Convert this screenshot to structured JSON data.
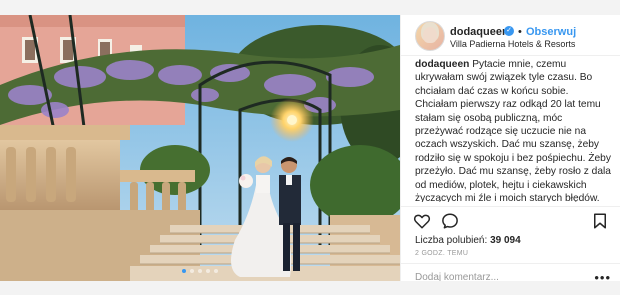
{
  "post": {
    "username": "dodaqueen",
    "verified_mark": "✓",
    "separator": "•",
    "follow_label": "Obserwuj",
    "location": "Villa Padierna Hotels & Resorts",
    "caption_user": "dodaqueen",
    "caption_text": "Pytacie mnie, czemu ukrywałam swój związek tyle czasu. Bo chciałam dać czas w końcu sobie. Chciałam pierwszy raz odkąd 20 lat temu stałam się osobą publiczną, móc przeżywać rodzące się uczucie nie na oczach wszyskich. Dać mu szansę, żeby rodziło się w spokoju i bez pośpiechu. Żeby przeżyło. Dać mu szansę, żeby rosło z dala od mediów, plotek, hejtu i ciekawskich życzących mi źle i moich starych błędów. Dać mu szansę, by",
    "likes_label": "Liczba polubień:",
    "likes_count": "39 094",
    "time_ago": "2 GODZ. TEMU",
    "comment_placeholder": "Dodaj komentarz...",
    "more_options": "•••",
    "carousel": {
      "count": 5,
      "active_index": 0
    }
  },
  "icons": {
    "heart": "heart-icon",
    "comment": "comment-icon",
    "bookmark": "bookmark-icon",
    "verified": "verified-badge-icon"
  },
  "colors": {
    "link": "#3897f0",
    "text": "#262626",
    "muted": "#999999"
  }
}
